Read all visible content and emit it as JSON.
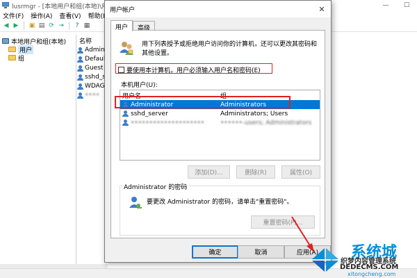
{
  "background_window": {
    "title": "lusrmgr - [本地用户和组(本地)\\用户]",
    "menu": [
      "文件(F)",
      "操作(A)",
      "查看(V)",
      "帮助(H)"
    ],
    "tree": [
      {
        "label": "本地用户和组(本地)"
      },
      {
        "label": "用户"
      },
      {
        "label": "组"
      }
    ],
    "list_header": "名称",
    "list_items": [
      "Admini",
      "Default",
      "Guest",
      "sshd_se",
      "WDAGU",
      "••••"
    ]
  },
  "dialog": {
    "title": "用户帐户",
    "close_glyph": "✕",
    "tabs": [
      "用户",
      "高级"
    ],
    "info_text": "用下列表授予或拒绝用户访问你的计算机，还可以更改其密码和其他设置。",
    "checkbox_label": "要使用本计算机，用户必须输入用户名和密码(E)",
    "users_label": "本机用户(U):",
    "table": {
      "headers": [
        "用户名",
        "组"
      ],
      "rows": [
        {
          "name": "Administrator",
          "group": "Administrators"
        },
        {
          "name": "sshd_server",
          "group": "Administrators; Users"
        },
        {
          "name": "••••••••••••••••••••",
          "group": "••••••-users; Administrators"
        }
      ]
    },
    "buttons": {
      "add": "添加(D)...",
      "remove": "删除(R)",
      "properties": "属性(O)",
      "reset_password": "重置密码(P)...",
      "ok": "确定",
      "cancel": "取消",
      "apply": "应用(A)"
    },
    "password_group": {
      "title": "Administrator 的密码",
      "text": "要更改 Administrator 的密码，请单击\"重置密码\"。"
    }
  },
  "watermark": {
    "big": "系统城",
    "sub": "织梦内容管理系统",
    "url": "DEDECMS.COM",
    "site": "xitongcheng.com"
  },
  "colors": {
    "selection": "#0078d7",
    "highlight_box": "#e02020",
    "watermark": "#0a8fd6"
  }
}
